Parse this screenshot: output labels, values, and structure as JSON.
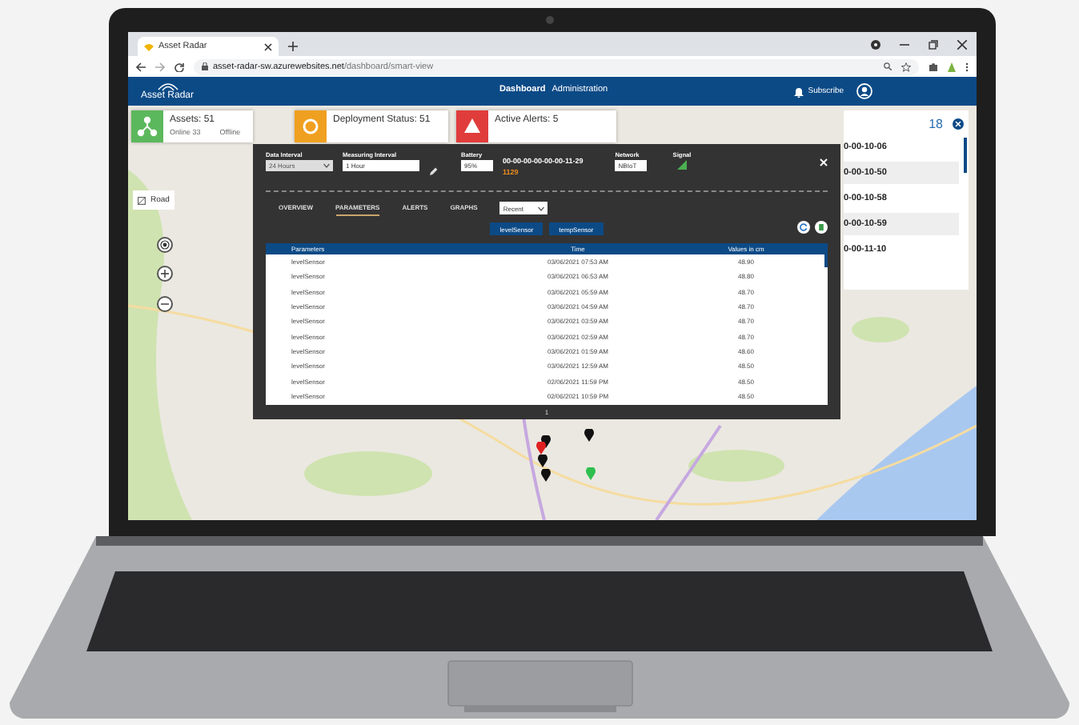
{
  "browser": {
    "tab_title": "Asset Radar",
    "url_host": "asset-radar-sw.azurewebsites.net",
    "url_path": "/dashboard/smart-view"
  },
  "app_header": {
    "logo_text": "Asset Radar",
    "nav": [
      {
        "label": "Dashboard",
        "selected": true
      },
      {
        "label": "Administration",
        "selected": false
      }
    ],
    "subscribe": "Subscribe"
  },
  "summary_cards": [
    {
      "kind": "assets",
      "title": "Assets: 51",
      "details": [
        "Online 33",
        "Offline"
      ],
      "color": "#5cb85c"
    },
    {
      "kind": "deployment",
      "title": "Deployment Status: 51",
      "color": "#f0a020"
    },
    {
      "kind": "alerts",
      "title": "Active Alerts: 5",
      "color": "#e03c3c"
    }
  ],
  "map_controls": {
    "layer": "Road"
  },
  "pins": [
    {
      "color": "#111111"
    },
    {
      "color": "#e02020"
    },
    {
      "color": "#111111"
    },
    {
      "color": "#111111"
    },
    {
      "color": "#111111"
    },
    {
      "color": "#2fbf4f"
    }
  ],
  "asset_panel": {
    "count": "18",
    "items": [
      "0-00-10-06",
      "0-00-10-50",
      "0-00-10-58",
      "0-00-10-59",
      "0-00-11-10"
    ]
  },
  "modal": {
    "data_interval": {
      "label": "Data Interval",
      "value": "24 Hours"
    },
    "measuring_interval": {
      "label": "Measuring Interval",
      "value": "1 Hour"
    },
    "battery": {
      "label": "Battery",
      "value": "95%"
    },
    "device": {
      "id": "00-00-00-00-00-00-11-29",
      "short_id": "1129"
    },
    "network": {
      "label": "Network",
      "value": "NBIoT"
    },
    "signal": {
      "label": "Signal"
    },
    "tabs": [
      {
        "label": "OVERVIEW",
        "selected": false
      },
      {
        "label": "PARAMETERS",
        "selected": true
      },
      {
        "label": "ALERTS",
        "selected": false
      },
      {
        "label": "GRAPHS",
        "selected": false
      }
    ],
    "range_select": "Recent",
    "sensors": [
      "levelSensor",
      "tempSensor"
    ],
    "table": {
      "columns": [
        "Parameters",
        "Time",
        "Values in cm"
      ],
      "rows": [
        [
          "levelSensor",
          "03/06/2021 07:53 AM",
          "48.90"
        ],
        [
          "levelSensor",
          "03/06/2021 06:53 AM",
          "48.80"
        ],
        [
          "levelSensor",
          "03/06/2021 05:59 AM",
          "48.70"
        ],
        [
          "levelSensor",
          "03/06/2021 04:59 AM",
          "48.70"
        ],
        [
          "levelSensor",
          "03/06/2021 03:59 AM",
          "48.70"
        ],
        [
          "levelSensor",
          "03/06/2021 02:59 AM",
          "48.70"
        ],
        [
          "levelSensor",
          "03/06/2021 01:59 AM",
          "48.60"
        ],
        [
          "levelSensor",
          "03/06/2021 12:59 AM",
          "48.50"
        ],
        [
          "levelSensor",
          "02/06/2021 11:59 PM",
          "48.50"
        ],
        [
          "levelSensor",
          "02/06/2021 10:59 PM",
          "48.50"
        ]
      ]
    },
    "page": "1"
  }
}
